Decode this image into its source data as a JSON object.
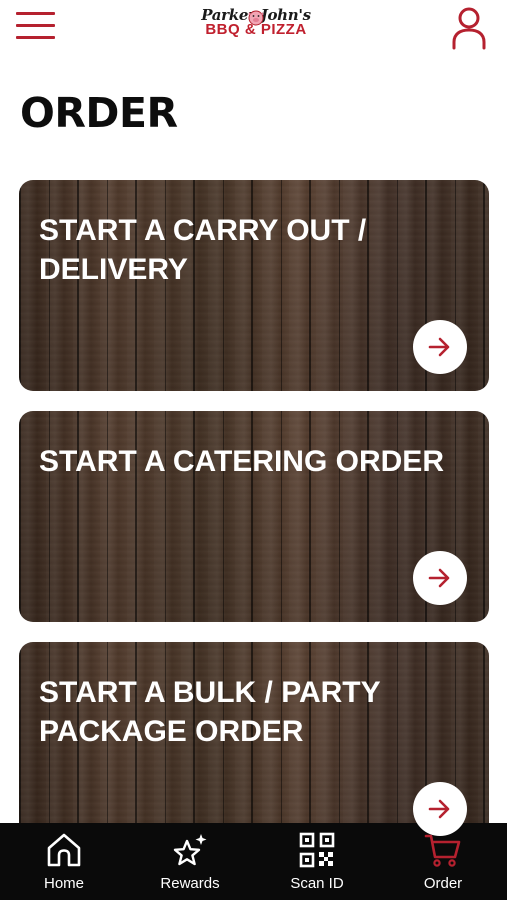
{
  "header": {
    "logo_line1": "Parker John's",
    "logo_line2": "BBQ & PIZZA",
    "menu_icon": "hamburger-menu-icon",
    "profile_icon": "user-profile-icon"
  },
  "page": {
    "title": "ORDER"
  },
  "cards": [
    {
      "title": "START A CARRY OUT / DELIVERY",
      "icon": "arrow-right-icon"
    },
    {
      "title": "START A CATERING ORDER",
      "icon": "arrow-right-icon"
    },
    {
      "title": "START A BULK / PARTY PACKAGE ORDER",
      "icon": "arrow-right-icon"
    }
  ],
  "tabbar": {
    "tabs": [
      {
        "label": "Home",
        "icon": "home-icon"
      },
      {
        "label": "Rewards",
        "icon": "rewards-star-icon"
      },
      {
        "label": "Scan ID",
        "icon": "qr-code-icon"
      },
      {
        "label": "Order",
        "icon": "cart-icon",
        "active": true
      }
    ]
  },
  "colors": {
    "accent": "#b5212f",
    "tabbar_bg": "#0a0a0a",
    "title_text": "#0d0d0d",
    "card_text": "#ffffff"
  }
}
